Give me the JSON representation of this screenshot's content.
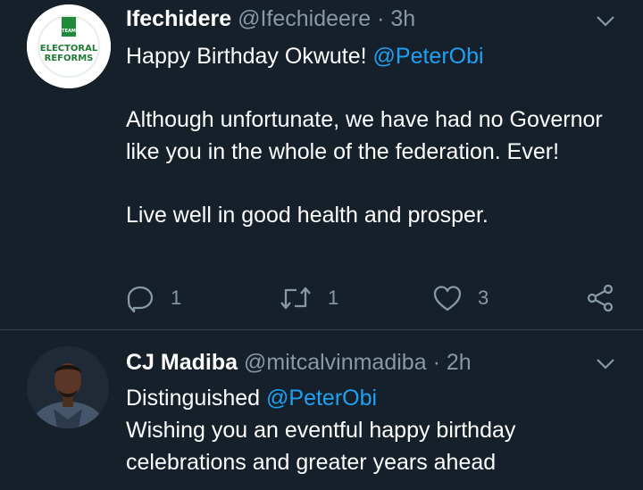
{
  "tweets": [
    {
      "avatar_text": {
        "line1": "ELECTORAL",
        "line2": "REFORMS",
        "badge": "TEAM"
      },
      "name": "Ifechidere",
      "handle": "@Ifechideere",
      "separator": "·",
      "time": "3h",
      "paragraphs": [
        {
          "text": "Happy Birthday Okwute! ",
          "mention": "@PeterObi"
        },
        {
          "text": "Although unfortunate, we have had no Governor like you in the whole of the federation. Ever!"
        },
        {
          "text": "Live well in good health and prosper."
        }
      ],
      "actions": {
        "replies": "1",
        "retweets": "1",
        "likes": "3"
      }
    },
    {
      "name": "CJ Madiba",
      "handle": "@mitcalvinmadiba",
      "separator": "·",
      "time": "2h",
      "line1_text": "Distinguished ",
      "line1_mention": "@PeterObi",
      "line2": "Wishing you an eventful happy birthday",
      "line3": "celebrations and greater years ahead"
    }
  ],
  "colors": {
    "background": "#15202b",
    "secondary_text": "#8899a6",
    "mention": "#1da1f2",
    "divider": "#38444d"
  },
  "icons": [
    "chevron-down-icon",
    "reply-icon",
    "retweet-icon",
    "like-icon",
    "share-icon"
  ]
}
